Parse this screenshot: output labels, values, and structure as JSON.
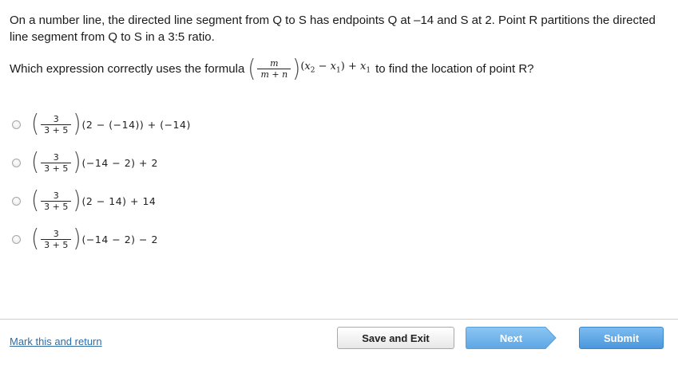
{
  "question": {
    "text": "On a number line, the directed line segment from Q to S has endpoints Q at –14 and S at 2. Point R partitions the directed line segment from Q to S in a 3:5 ratio.",
    "prompt_before": "Which expression correctly uses the formula",
    "formula": {
      "num": "m",
      "den": "m + n",
      "body_a": "x",
      "body_a_sub": "2",
      "minus": " − ",
      "body_b": "x",
      "body_b_sub": "1",
      "plus": " + ",
      "body_c": "x",
      "body_c_sub": "1"
    },
    "prompt_after": "to find the location of point R?"
  },
  "options": [
    {
      "num": "3",
      "den": "3 + 5",
      "expr": "(2 − (−14)) + (−14)"
    },
    {
      "num": "3",
      "den": "3 + 5",
      "expr": "(−14 − 2) + 2"
    },
    {
      "num": "3",
      "den": "3 + 5",
      "expr": "(2 − 14) + 14"
    },
    {
      "num": "3",
      "den": "3 + 5",
      "expr": "(−14 − 2) − 2"
    }
  ],
  "footer": {
    "mark_link": "Mark this and return",
    "save_label": "Save and Exit",
    "next_label": "Next",
    "submit_label": "Submit"
  },
  "colors": {
    "link": "#2e6da4",
    "next_button": "#69aee8",
    "submit_button": "#4a97dc"
  }
}
